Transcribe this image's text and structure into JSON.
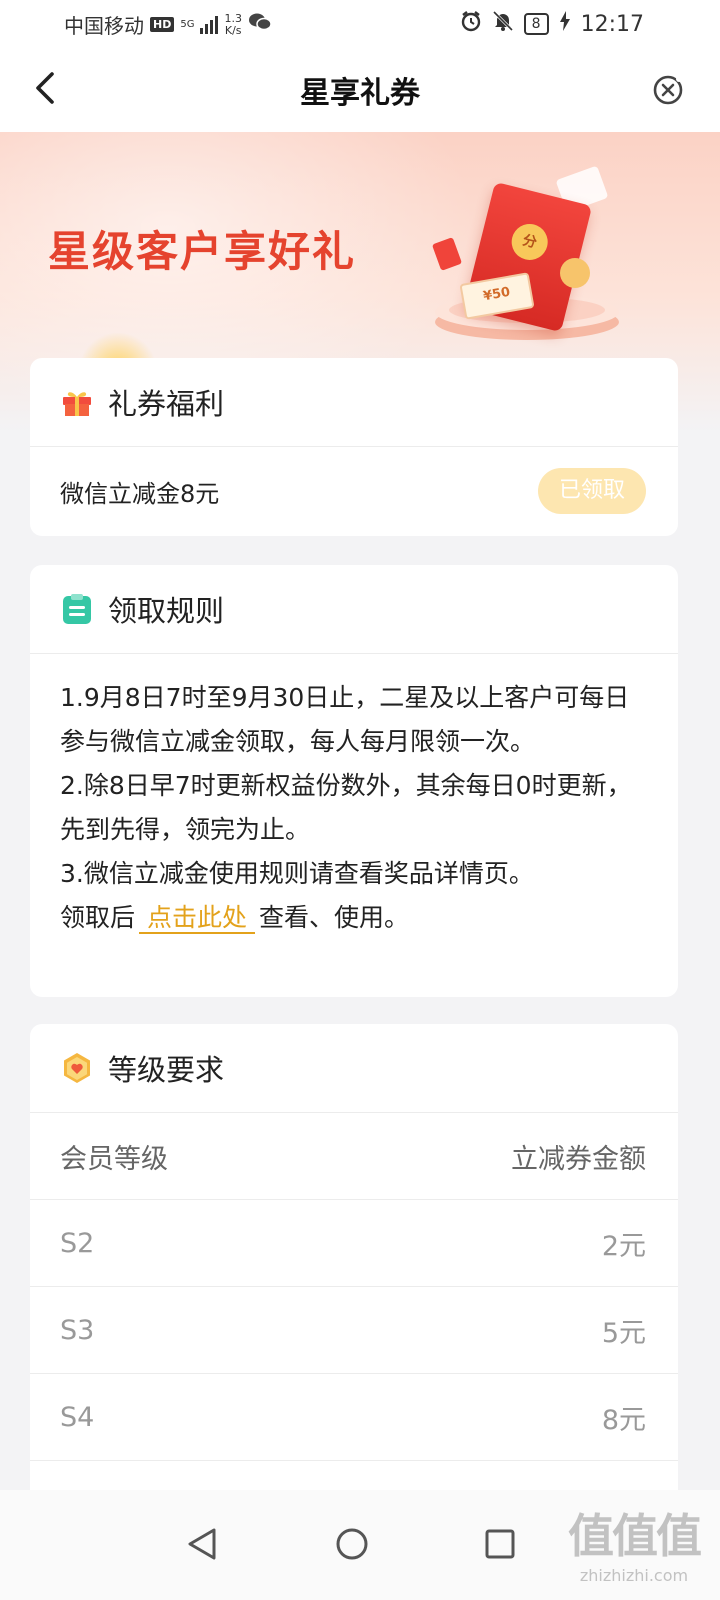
{
  "status_bar": {
    "carrier": "中国移动",
    "hd": "HD",
    "network": "5G",
    "speed_value": "1.3",
    "speed_unit": "K/s",
    "battery": "8",
    "time": "12:17"
  },
  "header": {
    "title": "星享礼券"
  },
  "banner": {
    "title": "星级客户享好礼",
    "coupon_text": "¥50",
    "coin_text": "分"
  },
  "benefit_card": {
    "title": "礼券福利",
    "item_name": "微信立减金8元",
    "button_label": "已领取"
  },
  "rules_card": {
    "title": "领取规则",
    "rule1": "1.9月8日7时至9月30日止，二星及以上客户可每日参与微信立减金领取，每人每月限领一次。",
    "rule2": "2.除8日早7时更新权益份数外，其余每日0时更新，先到先得，领完为止。",
    "rule3": "3.微信立减金使用规则请查看奖品详情页。",
    "after_prefix": "领取后",
    "link_text": "点击此处",
    "after_suffix": "查看、使用。"
  },
  "levels_card": {
    "title": "等级要求",
    "col_level": "会员等级",
    "col_amount": "立减券金额",
    "rows": [
      {
        "level": "S2",
        "amount": "2元"
      },
      {
        "level": "S3",
        "amount": "5元"
      },
      {
        "level": "S4",
        "amount": "8元"
      }
    ]
  },
  "watermark": {
    "big": "值值值",
    "small": "zhizhizhi.com"
  },
  "colors": {
    "accent_link": "#e3a21b",
    "banner_title": "#e5432e",
    "claimed_button": "#fde6b0"
  },
  "icons": [
    "back-arrow-icon",
    "close-circle-icon",
    "gift-icon",
    "clipboard-icon",
    "badge-icon",
    "nav-back-icon",
    "nav-home-icon",
    "nav-recent-icon"
  ]
}
